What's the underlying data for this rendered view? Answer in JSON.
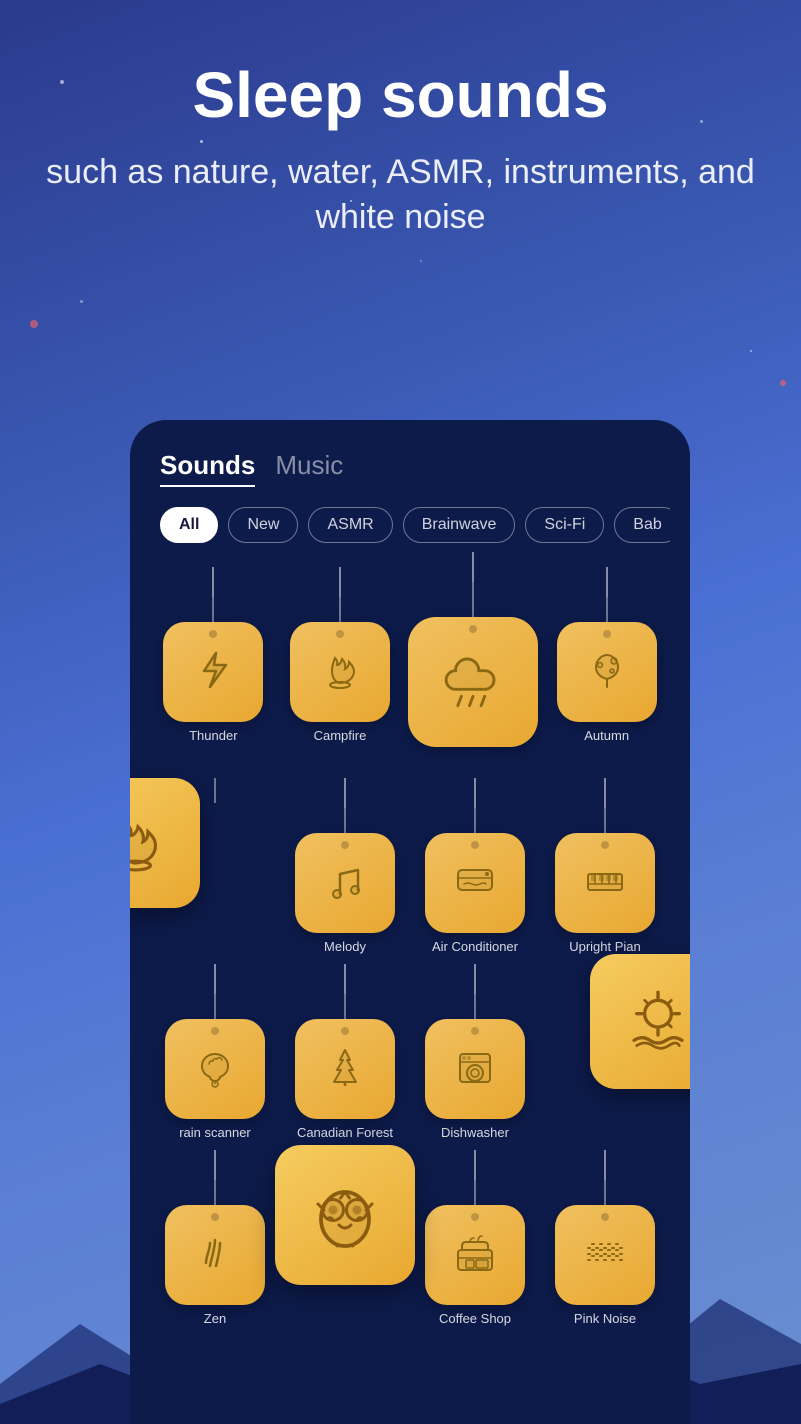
{
  "header": {
    "title": "Sleep sounds",
    "subtitle": "such as nature, water, ASMR, instruments, and white noise"
  },
  "tabs": [
    {
      "label": "Sounds",
      "active": true
    },
    {
      "label": "Music",
      "active": false
    }
  ],
  "filters": [
    {
      "label": "All",
      "active": true
    },
    {
      "label": "New",
      "active": false
    },
    {
      "label": "ASMR",
      "active": false
    },
    {
      "label": "Brainwave",
      "active": false
    },
    {
      "label": "Sci-Fi",
      "active": false
    },
    {
      "label": "Bab",
      "active": false
    }
  ],
  "sounds": [
    {
      "id": "thunder",
      "label": "Thunder",
      "icon": "thunder"
    },
    {
      "id": "campfire",
      "label": "Campfire",
      "icon": "campfire"
    },
    {
      "id": "rain",
      "label": "Rain",
      "icon": "rain",
      "featured": true
    },
    {
      "id": "autumn",
      "label": "Autumn",
      "icon": "autumn"
    },
    {
      "id": "campfire2",
      "label": "",
      "icon": "campfire",
      "popout": true
    },
    {
      "id": "melody",
      "label": "Melody",
      "icon": "melody"
    },
    {
      "id": "airconditioner",
      "label": "Air Conditioner",
      "icon": "airconditioner"
    },
    {
      "id": "uprightpiano",
      "label": "Upright Pian",
      "icon": "piano"
    },
    {
      "id": "brainscanner",
      "label": "rain scanner",
      "icon": "brainscanner"
    },
    {
      "id": "canadianforest",
      "label": "Canadian Forest",
      "icon": "forest"
    },
    {
      "id": "dishwasher",
      "label": "Dishwasher",
      "icon": "dishwasher"
    },
    {
      "id": "ocean",
      "label": "",
      "icon": "ocean",
      "popout2": true
    },
    {
      "id": "zen",
      "label": "Zen",
      "icon": "zen"
    },
    {
      "id": "owl",
      "label": "",
      "icon": "owl",
      "popout3": true
    },
    {
      "id": "coffeeshop",
      "label": "Coffee Shop",
      "icon": "coffeeshop"
    },
    {
      "id": "pinknoise",
      "label": "Pink Noise",
      "icon": "pinknoise"
    }
  ],
  "colors": {
    "bg_gradient_start": "#2a3a8c",
    "bg_gradient_end": "#4a6fd4",
    "phone_bg": "#0d1b4b",
    "tile_warm": "#f0c060",
    "tile_dark": "#e8a830"
  }
}
